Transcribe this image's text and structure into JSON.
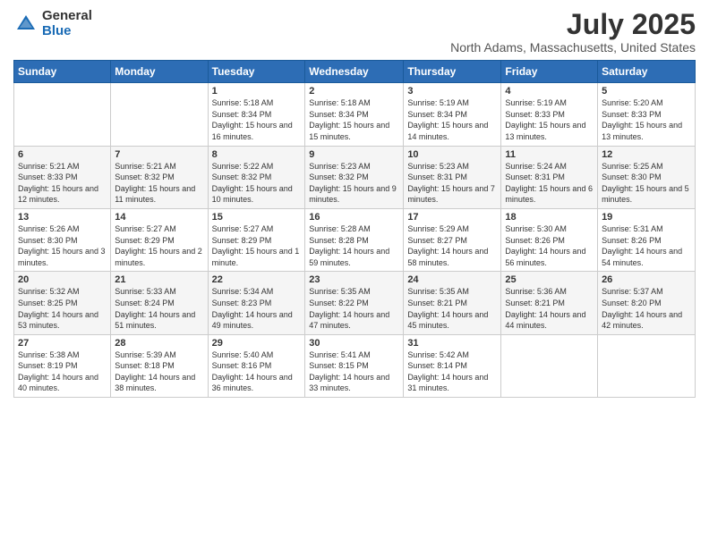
{
  "header": {
    "logo_general": "General",
    "logo_blue": "Blue",
    "title": "July 2025",
    "subtitle": "North Adams, Massachusetts, United States"
  },
  "days_of_week": [
    "Sunday",
    "Monday",
    "Tuesday",
    "Wednesday",
    "Thursday",
    "Friday",
    "Saturday"
  ],
  "weeks": [
    [
      {
        "num": "",
        "info": ""
      },
      {
        "num": "",
        "info": ""
      },
      {
        "num": "1",
        "info": "Sunrise: 5:18 AM\nSunset: 8:34 PM\nDaylight: 15 hours and 16 minutes."
      },
      {
        "num": "2",
        "info": "Sunrise: 5:18 AM\nSunset: 8:34 PM\nDaylight: 15 hours and 15 minutes."
      },
      {
        "num": "3",
        "info": "Sunrise: 5:19 AM\nSunset: 8:34 PM\nDaylight: 15 hours and 14 minutes."
      },
      {
        "num": "4",
        "info": "Sunrise: 5:19 AM\nSunset: 8:33 PM\nDaylight: 15 hours and 13 minutes."
      },
      {
        "num": "5",
        "info": "Sunrise: 5:20 AM\nSunset: 8:33 PM\nDaylight: 15 hours and 13 minutes."
      }
    ],
    [
      {
        "num": "6",
        "info": "Sunrise: 5:21 AM\nSunset: 8:33 PM\nDaylight: 15 hours and 12 minutes."
      },
      {
        "num": "7",
        "info": "Sunrise: 5:21 AM\nSunset: 8:32 PM\nDaylight: 15 hours and 11 minutes."
      },
      {
        "num": "8",
        "info": "Sunrise: 5:22 AM\nSunset: 8:32 PM\nDaylight: 15 hours and 10 minutes."
      },
      {
        "num": "9",
        "info": "Sunrise: 5:23 AM\nSunset: 8:32 PM\nDaylight: 15 hours and 9 minutes."
      },
      {
        "num": "10",
        "info": "Sunrise: 5:23 AM\nSunset: 8:31 PM\nDaylight: 15 hours and 7 minutes."
      },
      {
        "num": "11",
        "info": "Sunrise: 5:24 AM\nSunset: 8:31 PM\nDaylight: 15 hours and 6 minutes."
      },
      {
        "num": "12",
        "info": "Sunrise: 5:25 AM\nSunset: 8:30 PM\nDaylight: 15 hours and 5 minutes."
      }
    ],
    [
      {
        "num": "13",
        "info": "Sunrise: 5:26 AM\nSunset: 8:30 PM\nDaylight: 15 hours and 3 minutes."
      },
      {
        "num": "14",
        "info": "Sunrise: 5:27 AM\nSunset: 8:29 PM\nDaylight: 15 hours and 2 minutes."
      },
      {
        "num": "15",
        "info": "Sunrise: 5:27 AM\nSunset: 8:29 PM\nDaylight: 15 hours and 1 minute."
      },
      {
        "num": "16",
        "info": "Sunrise: 5:28 AM\nSunset: 8:28 PM\nDaylight: 14 hours and 59 minutes."
      },
      {
        "num": "17",
        "info": "Sunrise: 5:29 AM\nSunset: 8:27 PM\nDaylight: 14 hours and 58 minutes."
      },
      {
        "num": "18",
        "info": "Sunrise: 5:30 AM\nSunset: 8:26 PM\nDaylight: 14 hours and 56 minutes."
      },
      {
        "num": "19",
        "info": "Sunrise: 5:31 AM\nSunset: 8:26 PM\nDaylight: 14 hours and 54 minutes."
      }
    ],
    [
      {
        "num": "20",
        "info": "Sunrise: 5:32 AM\nSunset: 8:25 PM\nDaylight: 14 hours and 53 minutes."
      },
      {
        "num": "21",
        "info": "Sunrise: 5:33 AM\nSunset: 8:24 PM\nDaylight: 14 hours and 51 minutes."
      },
      {
        "num": "22",
        "info": "Sunrise: 5:34 AM\nSunset: 8:23 PM\nDaylight: 14 hours and 49 minutes."
      },
      {
        "num": "23",
        "info": "Sunrise: 5:35 AM\nSunset: 8:22 PM\nDaylight: 14 hours and 47 minutes."
      },
      {
        "num": "24",
        "info": "Sunrise: 5:35 AM\nSunset: 8:21 PM\nDaylight: 14 hours and 45 minutes."
      },
      {
        "num": "25",
        "info": "Sunrise: 5:36 AM\nSunset: 8:21 PM\nDaylight: 14 hours and 44 minutes."
      },
      {
        "num": "26",
        "info": "Sunrise: 5:37 AM\nSunset: 8:20 PM\nDaylight: 14 hours and 42 minutes."
      }
    ],
    [
      {
        "num": "27",
        "info": "Sunrise: 5:38 AM\nSunset: 8:19 PM\nDaylight: 14 hours and 40 minutes."
      },
      {
        "num": "28",
        "info": "Sunrise: 5:39 AM\nSunset: 8:18 PM\nDaylight: 14 hours and 38 minutes."
      },
      {
        "num": "29",
        "info": "Sunrise: 5:40 AM\nSunset: 8:16 PM\nDaylight: 14 hours and 36 minutes."
      },
      {
        "num": "30",
        "info": "Sunrise: 5:41 AM\nSunset: 8:15 PM\nDaylight: 14 hours and 33 minutes."
      },
      {
        "num": "31",
        "info": "Sunrise: 5:42 AM\nSunset: 8:14 PM\nDaylight: 14 hours and 31 minutes."
      },
      {
        "num": "",
        "info": ""
      },
      {
        "num": "",
        "info": ""
      }
    ]
  ]
}
